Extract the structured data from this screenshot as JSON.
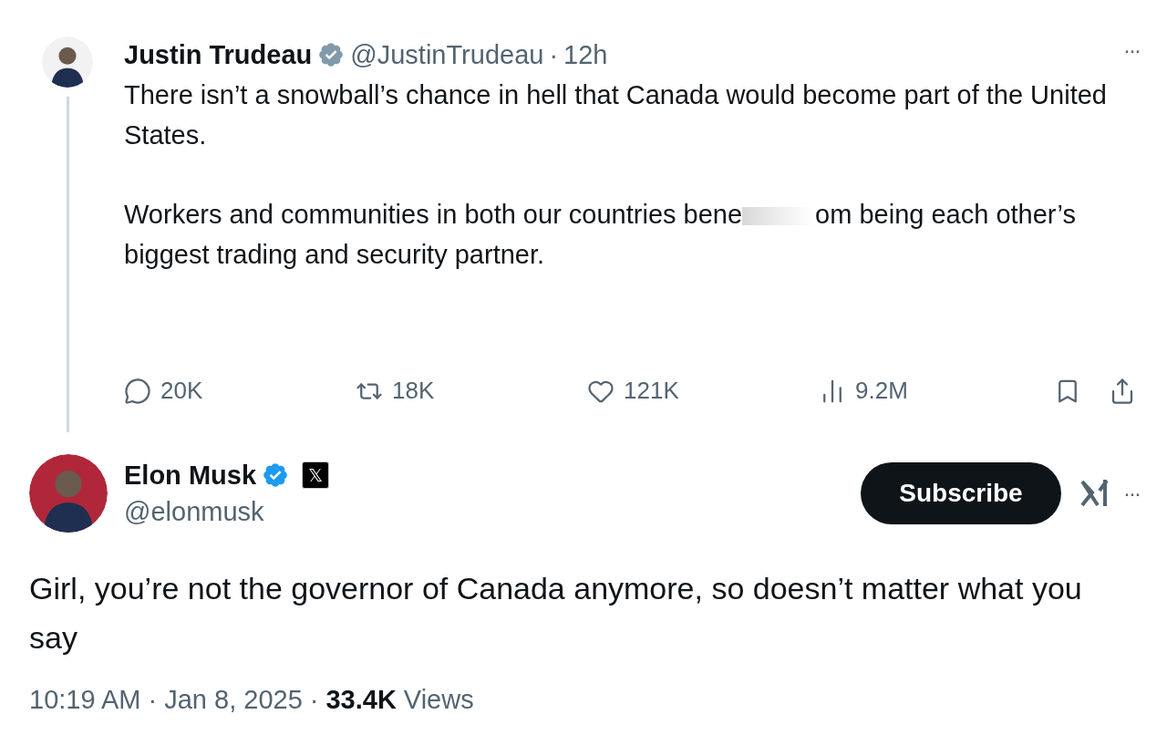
{
  "original_tweet": {
    "name": "Justin Trudeau",
    "badge": {
      "kind": "government"
    },
    "handle": "@JustinTrudeau",
    "separator": "·",
    "time": "12h",
    "more": "···",
    "paragraphs": [
      {
        "before": "There isn’t a snowball’s chance in hell that Canada would become part of the United States."
      },
      {
        "before": "Workers and communities in both our countries bene",
        "obscured": true,
        "after": "om being each other’s biggest trading and security partner."
      }
    ],
    "actions": [
      {
        "kind": "reply",
        "count": "20K"
      },
      {
        "kind": "repost",
        "count": "18K"
      },
      {
        "kind": "like",
        "count": "121K"
      },
      {
        "kind": "views",
        "count": "9.2M"
      }
    ]
  },
  "reply": {
    "name": "Elon Musk",
    "badge": {
      "kind": "blue"
    },
    "affiliate": "𝕏",
    "handle": "@elonmusk",
    "subscribe": "Subscribe",
    "more": "···",
    "text": "Girl, you’re not the governor of Canada anymore, so doesn’t matter what you say",
    "footer": {
      "time": "10:19 AM",
      "sep1": "·",
      "date": "Jan 8, 2025",
      "sep2": "·",
      "views": "33.4K",
      "views_label": "Views"
    }
  }
}
